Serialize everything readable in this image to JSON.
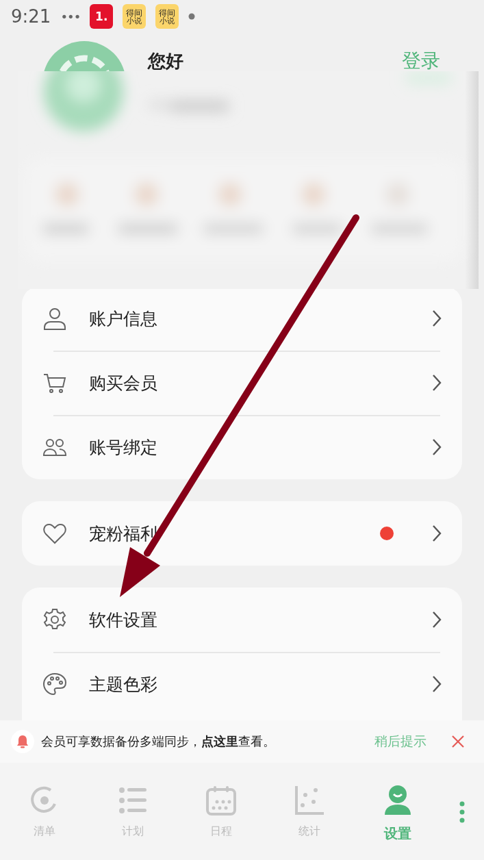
{
  "status_bar": {
    "time": "9:21",
    "overflow": "•••",
    "app_icons": [
      {
        "kind": "number",
        "label": "1."
      },
      {
        "kind": "book",
        "label": "得间",
        "sublabel": "小说"
      },
      {
        "kind": "book",
        "label": "得间",
        "sublabel": "小说"
      }
    ]
  },
  "profile": {
    "greeting": "您好",
    "login": "登录"
  },
  "menu_cards": [
    {
      "items": [
        {
          "label": "账户信息",
          "dot": false
        },
        {
          "label": "购买会员",
          "dot": false
        },
        {
          "label": "账号绑定",
          "dot": false
        }
      ]
    },
    {
      "items": [
        {
          "label": "宠粉福利",
          "dot": true
        }
      ]
    },
    {
      "items": [
        {
          "label": "软件设置",
          "dot": false
        },
        {
          "label": "主题色彩",
          "dot": false
        }
      ]
    }
  ],
  "notice": {
    "text": "会员可享数据备份多端同步，**点这里**查看。",
    "later": "稍后提示"
  },
  "tab_bar": [
    {
      "label": "清单",
      "selected": false
    },
    {
      "label": "计划",
      "selected": false
    },
    {
      "label": "日程",
      "selected": false
    },
    {
      "label": "统计",
      "selected": false
    },
    {
      "label": "设置",
      "selected": true
    }
  ]
}
